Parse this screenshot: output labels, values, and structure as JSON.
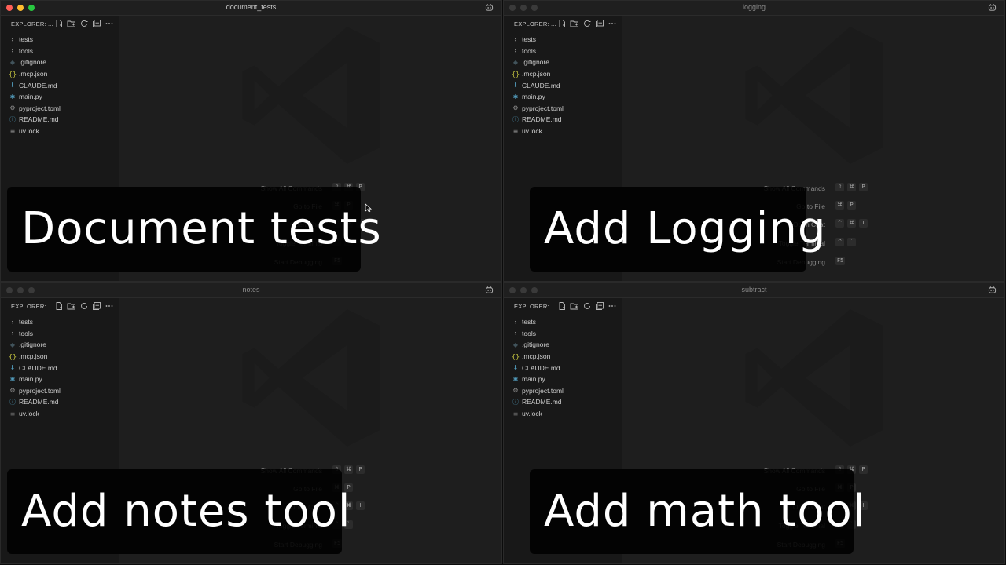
{
  "explorer": {
    "header": "EXPLORER: ...",
    "items": [
      {
        "label": "tests",
        "icon": "chevron-right",
        "glyph": "›",
        "color": "#cccccc"
      },
      {
        "label": "tools",
        "icon": "chevron-right",
        "glyph": "›",
        "color": "#cccccc"
      },
      {
        "label": ".gitignore",
        "icon": "git-diamond",
        "glyph": "◆",
        "color": "#41535b"
      },
      {
        "label": ".mcp.json",
        "icon": "json-braces",
        "glyph": "{}",
        "color": "#cbcb41"
      },
      {
        "label": "CLAUDE.md",
        "icon": "markdown-arrow",
        "glyph": "⬇",
        "color": "#519aba"
      },
      {
        "label": "main.py",
        "icon": "python",
        "glyph": "✱",
        "color": "#519aba"
      },
      {
        "label": "pyproject.toml",
        "icon": "gear",
        "glyph": "⚙",
        "color": "#8a8a8a"
      },
      {
        "label": "README.md",
        "icon": "info",
        "glyph": "ⓘ",
        "color": "#519aba"
      },
      {
        "label": "uv.lock",
        "icon": "lines",
        "glyph": "≡",
        "color": "#8a8a8a"
      }
    ]
  },
  "shortcuts": [
    {
      "label": "Show All Commands",
      "keys": [
        "⇧",
        "⌘",
        "P"
      ]
    },
    {
      "label": "Go to File",
      "keys": [
        "⌘",
        "P"
      ]
    },
    {
      "label": "Open Chat",
      "keys": [
        "^",
        "⌘",
        "I"
      ]
    },
    {
      "label": "Toggle Terminal",
      "keys": [
        "^",
        "`"
      ]
    },
    {
      "label": "Start Debugging",
      "keys": [
        "F5"
      ]
    }
  ],
  "windows": [
    {
      "title": "document_tests",
      "overlay": "Document tests",
      "active": true
    },
    {
      "title": "logging",
      "overlay": "Add Logging",
      "active": false
    },
    {
      "title": "notes",
      "overlay": "Add notes tool",
      "active": false
    },
    {
      "title": "subtract",
      "overlay": "Add math tool",
      "active": false
    }
  ],
  "colors": {
    "editor_bg": "#1e1e1e",
    "sidebar_bg": "#181818",
    "overlay_bg": "#000000",
    "overlay_text": "#ffffff"
  }
}
